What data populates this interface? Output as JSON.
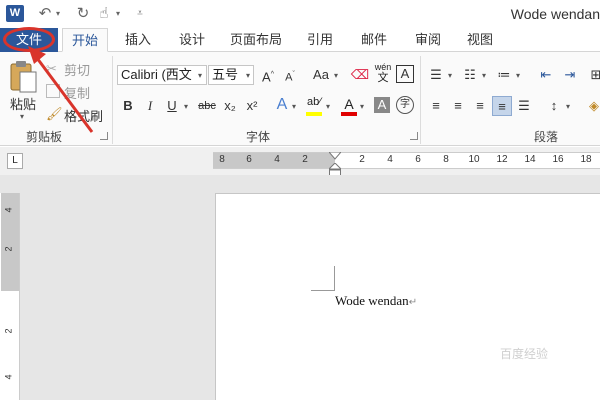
{
  "app": {
    "logo_letter": "W",
    "doc_title": "Wode wendan"
  },
  "quick_access": {
    "icons": [
      "undo-icon",
      "redo-icon",
      "touch-mode-icon",
      "customize-icon"
    ]
  },
  "tabs": [
    "文件",
    "开始",
    "插入",
    "设计",
    "页面布局",
    "引用",
    "邮件",
    "审阅",
    "视图"
  ],
  "active_tab": "开始",
  "clipboard": {
    "paste": "粘贴",
    "cut": "剪切",
    "copy": "复制",
    "format_painter": "格式刷",
    "group_label": "剪贴板"
  },
  "font": {
    "font_name": "Calibri (西文",
    "font_size": "五号",
    "change_case": "Aa",
    "phonetic_top": "wén",
    "phonetic_bottom": "文",
    "border_char": "A",
    "shade_char": "A",
    "enclose_char": "字",
    "bold": "B",
    "italic": "I",
    "underline": "U",
    "strike": "abc",
    "subscript": "x₂",
    "superscript": "x²",
    "group_label": "字体"
  },
  "paragraph": {
    "group_label": "段落"
  },
  "ruler": {
    "tab_selector": "L",
    "labels": [
      "8",
      "6",
      "4",
      "2",
      "2",
      "4",
      "6",
      "8",
      "10",
      "12",
      "14",
      "16",
      "18"
    ]
  },
  "vruler": {
    "labels": [
      "4",
      "2",
      "2",
      "4"
    ]
  },
  "document": {
    "text": "Wode wendan"
  },
  "watermark": "百度经验",
  "colors": {
    "accent": "#2b579a",
    "annotation": "#d9342b",
    "highlight": "#ffff00",
    "font_color": "#e00000"
  }
}
